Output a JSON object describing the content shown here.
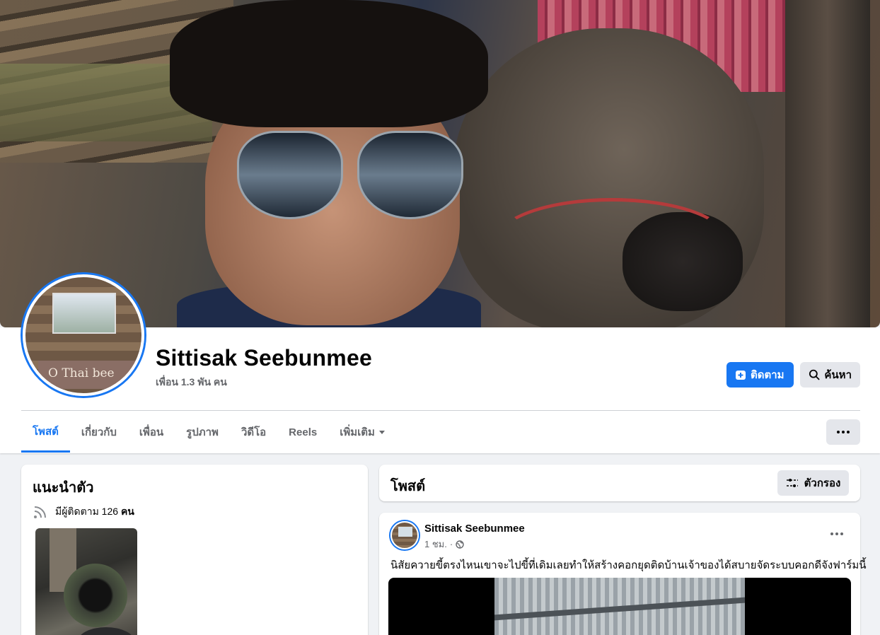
{
  "profile": {
    "name": "Sittisak Seebunmee",
    "friends": "เพื่อน 1.3 พัน คน",
    "avatar_sign_text": "O Thai bee"
  },
  "actions": {
    "follow_label": "ติดตาม",
    "search_label": "ค้นหา"
  },
  "tabs": [
    {
      "label": "โพสต์",
      "active": true
    },
    {
      "label": "เกี่ยวกับ"
    },
    {
      "label": "เพื่อน"
    },
    {
      "label": "รูปภาพ"
    },
    {
      "label": "วิดีโอ"
    },
    {
      "label": "Reels"
    },
    {
      "label": "เพิ่มเติม"
    }
  ],
  "intro": {
    "title": "แนะนำตัว",
    "followers_prefix": "มีผู้ติดตาม 126 ",
    "followers_suffix": "คน"
  },
  "posts_section": {
    "title": "โพสต์",
    "filter_label": "ตัวกรอง"
  },
  "post": {
    "author": "Sittisak Seebunmee",
    "time": "1 ชม.",
    "separator": "·",
    "text": "นิสัยควายขี้ตรงไหนเขาจะไปขี้ที่เดิมเลยทำให้สร้างคอกยุดติดบ้านเจ้าของได้สบายจัดระบบคอกดีจังฟาร์มนี้"
  },
  "colors": {
    "accent": "#1877f2",
    "background": "#f0f2f5",
    "secondary_text": "#65676b"
  }
}
